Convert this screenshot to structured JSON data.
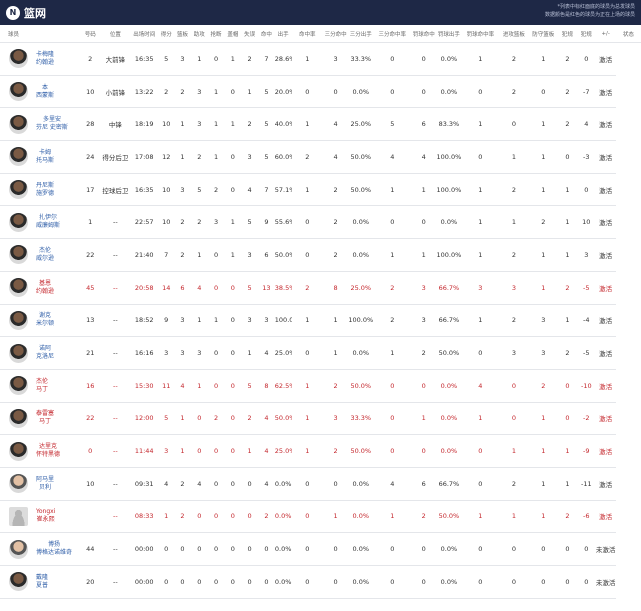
{
  "header": {
    "team_logo_icon": "nets-logo-icon",
    "team_name": "篮网",
    "note_line1": "*列表中标红面底的球员为总发球员",
    "note_line2": "数据颜色是红色的球员为正在上场的球员"
  },
  "columns": [
    "球员",
    "号码",
    "位置",
    "出场时间",
    "得分",
    "篮板",
    "助攻",
    "抢断",
    "盖帽",
    "失误",
    "命中",
    "出手",
    "命中率",
    "三分命中",
    "三分出手",
    "三分命中率",
    "罚球命中",
    "罚球出手",
    "罚球命中率",
    "进攻篮板",
    "防守篮板",
    "犯规",
    "犯规",
    "+/-",
    "状态"
  ],
  "colors": {
    "header_bg": "#1e2846",
    "on_court_red": "#c4272d",
    "name_blue": "#2f5ea8"
  },
  "players": [
    {
      "name1": "卡梅隆",
      "name2": "约翰逊",
      "avatar": "dark",
      "on_court": false,
      "stats": [
        "2",
        "大前锋",
        "16:35",
        "5",
        "3",
        "1",
        "0",
        "1",
        "2",
        "7",
        "28.6%",
        "1",
        "3",
        "33.3%",
        "0",
        "0",
        "0.0%",
        "1",
        "2",
        "1",
        "2",
        "0",
        "激活"
      ]
    },
    {
      "name1": "本",
      "name2": "西蒙斯",
      "avatar": "dark",
      "on_court": false,
      "stats": [
        "10",
        "小前锋",
        "13:22",
        "2",
        "2",
        "3",
        "1",
        "0",
        "1",
        "5",
        "20.0%",
        "0",
        "0",
        "0.0%",
        "0",
        "0",
        "0.0%",
        "0",
        "2",
        "0",
        "2",
        "-7",
        "激活"
      ]
    },
    {
      "name1": "多里安",
      "name2": "芬尼 史密斯",
      "avatar": "dark",
      "on_court": false,
      "stats": [
        "28",
        "中锋",
        "18:19",
        "10",
        "1",
        "3",
        "1",
        "1",
        "2",
        "5",
        "40.0%",
        "1",
        "4",
        "25.0%",
        "5",
        "6",
        "83.3%",
        "1",
        "0",
        "1",
        "2",
        "4",
        "激活"
      ]
    },
    {
      "name1": "卡姆",
      "name2": "托马斯",
      "avatar": "dark",
      "on_court": false,
      "stats": [
        "24",
        "得分后卫",
        "17:08",
        "12",
        "1",
        "2",
        "1",
        "0",
        "3",
        "5",
        "60.0%",
        "2",
        "4",
        "50.0%",
        "4",
        "4",
        "100.0%",
        "0",
        "1",
        "1",
        "0",
        "-3",
        "激活"
      ]
    },
    {
      "name1": "丹尼斯",
      "name2": "施罗德",
      "avatar": "dark",
      "on_court": false,
      "stats": [
        "17",
        "控球后卫",
        "16:35",
        "10",
        "3",
        "5",
        "2",
        "0",
        "4",
        "7",
        "57.1%",
        "1",
        "2",
        "50.0%",
        "1",
        "1",
        "100.0%",
        "1",
        "2",
        "1",
        "1",
        "0",
        "激活"
      ]
    },
    {
      "name1": "扎伊尔",
      "name2": "威廉姆斯",
      "avatar": "dark",
      "on_court": false,
      "stats": [
        "1",
        "--",
        "22:57",
        "10",
        "2",
        "2",
        "3",
        "1",
        "5",
        "9",
        "55.6%",
        "0",
        "2",
        "0.0%",
        "0",
        "0",
        "0.0%",
        "1",
        "1",
        "2",
        "1",
        "10",
        "激活"
      ]
    },
    {
      "name1": "杰伦",
      "name2": "威尔逊",
      "avatar": "dark",
      "on_court": false,
      "stats": [
        "22",
        "--",
        "21:40",
        "7",
        "2",
        "1",
        "0",
        "1",
        "3",
        "6",
        "50.0%",
        "0",
        "2",
        "0.0%",
        "1",
        "1",
        "100.0%",
        "1",
        "2",
        "1",
        "1",
        "3",
        "激活"
      ]
    },
    {
      "name1": "基恩",
      "name2": "约翰逊",
      "avatar": "dark",
      "on_court": true,
      "stats": [
        "45",
        "--",
        "20:58",
        "14",
        "6",
        "4",
        "0",
        "0",
        "5",
        "13",
        "38.5%",
        "2",
        "8",
        "25.0%",
        "2",
        "3",
        "66.7%",
        "3",
        "3",
        "1",
        "2",
        "-5",
        "激活"
      ]
    },
    {
      "name1": "谢克",
      "name2": "米尔顿",
      "avatar": "dark",
      "on_court": false,
      "stats": [
        "13",
        "--",
        "18:52",
        "9",
        "3",
        "1",
        "1",
        "0",
        "3",
        "3",
        "100.0%",
        "1",
        "1",
        "100.0%",
        "2",
        "3",
        "66.7%",
        "1",
        "2",
        "3",
        "1",
        "-4",
        "激活"
      ]
    },
    {
      "name1": "诺阿",
      "name2": "克洛尼",
      "avatar": "dark",
      "on_court": false,
      "stats": [
        "21",
        "--",
        "16:16",
        "3",
        "3",
        "3",
        "0",
        "0",
        "1",
        "4",
        "25.0%",
        "0",
        "1",
        "0.0%",
        "1",
        "2",
        "50.0%",
        "0",
        "3",
        "3",
        "2",
        "-5",
        "激活"
      ]
    },
    {
      "name1": "杰伦",
      "name2": "马丁",
      "avatar": "dark",
      "on_court": true,
      "stats": [
        "16",
        "--",
        "15:30",
        "11",
        "4",
        "1",
        "0",
        "0",
        "5",
        "8",
        "62.5%",
        "1",
        "2",
        "50.0%",
        "0",
        "0",
        "0.0%",
        "4",
        "0",
        "2",
        "0",
        "-10",
        "激活"
      ]
    },
    {
      "name1": "泰雷塞",
      "name2": "马丁",
      "avatar": "dark",
      "on_court": true,
      "stats": [
        "22",
        "--",
        "12:00",
        "5",
        "1",
        "0",
        "2",
        "0",
        "2",
        "4",
        "50.0%",
        "1",
        "3",
        "33.3%",
        "0",
        "1",
        "0.0%",
        "1",
        "0",
        "1",
        "0",
        "-2",
        "激活"
      ]
    },
    {
      "name1": "达里克",
      "name2": "怀特黑德",
      "avatar": "dark",
      "on_court": true,
      "stats": [
        "0",
        "--",
        "11:44",
        "3",
        "1",
        "0",
        "0",
        "0",
        "1",
        "4",
        "25.0%",
        "1",
        "2",
        "50.0%",
        "0",
        "0",
        "0.0%",
        "0",
        "1",
        "1",
        "1",
        "-9",
        "激活"
      ]
    },
    {
      "name1": "阿马里",
      "name2": "贝利",
      "avatar": "light",
      "on_court": false,
      "stats": [
        "10",
        "--",
        "09:31",
        "4",
        "2",
        "4",
        "0",
        "0",
        "0",
        "4",
        "0.0%",
        "0",
        "0",
        "0.0%",
        "4",
        "6",
        "66.7%",
        "0",
        "2",
        "1",
        "1",
        "-11",
        "激活"
      ]
    },
    {
      "name1": "Yongxi",
      "name2": "崔永熙",
      "avatar": "blank",
      "on_court": true,
      "stats": [
        "",
        "--",
        "08:33",
        "1",
        "2",
        "0",
        "0",
        "0",
        "0",
        "2",
        "0.0%",
        "0",
        "1",
        "0.0%",
        "1",
        "2",
        "50.0%",
        "1",
        "1",
        "1",
        "2",
        "-6",
        "激活"
      ]
    },
    {
      "name1": "博扬",
      "name2": "博格达诺维奇",
      "avatar": "light",
      "on_court": false,
      "stats": [
        "44",
        "--",
        "00:00",
        "0",
        "0",
        "0",
        "0",
        "0",
        "0",
        "0",
        "0.0%",
        "0",
        "0",
        "0.0%",
        "0",
        "0",
        "0.0%",
        "0",
        "0",
        "0",
        "0",
        "0",
        "未激活"
      ]
    },
    {
      "name1": "戴隆",
      "name2": "夏普",
      "avatar": "dark",
      "on_court": false,
      "stats": [
        "20",
        "--",
        "00:00",
        "0",
        "0",
        "0",
        "0",
        "0",
        "0",
        "0",
        "0.0%",
        "0",
        "0",
        "0.0%",
        "0",
        "0",
        "0.0%",
        "0",
        "0",
        "0",
        "0",
        "0",
        "未激活"
      ]
    }
  ]
}
